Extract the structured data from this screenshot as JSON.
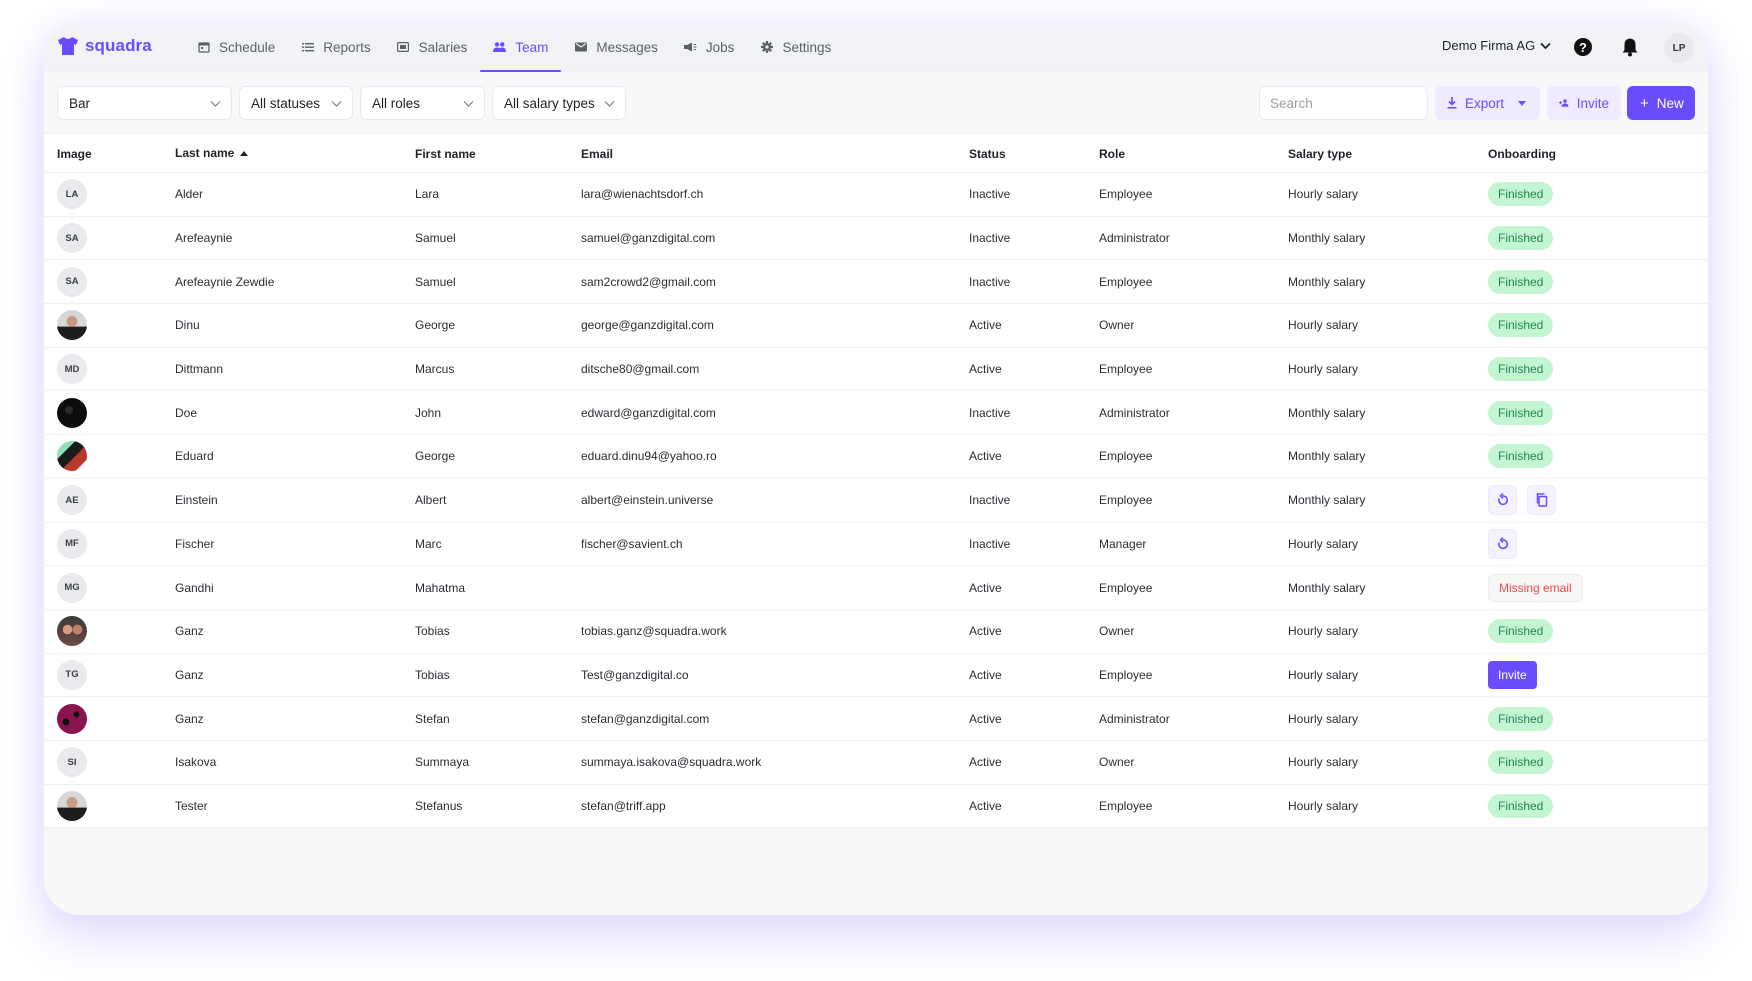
{
  "app": {
    "brand": "squadra",
    "brand_color": "#6a4cff"
  },
  "nav": {
    "items": [
      {
        "label": "Schedule",
        "icon": "calendar-icon",
        "active": false
      },
      {
        "label": "Reports",
        "icon": "list-icon",
        "active": false
      },
      {
        "label": "Salaries",
        "icon": "money-icon",
        "active": false
      },
      {
        "label": "Team",
        "icon": "people-icon",
        "active": true
      },
      {
        "label": "Messages",
        "icon": "mail-icon",
        "active": false
      },
      {
        "label": "Jobs",
        "icon": "megaphone-icon",
        "active": false
      },
      {
        "label": "Settings",
        "icon": "gear-icon",
        "active": false
      }
    ],
    "company": "Demo Firma AG",
    "user_initials": "LP"
  },
  "filters": {
    "location": "Bar",
    "status": "All statuses",
    "role": "All roles",
    "salary_type": "All salary types",
    "search_placeholder": "Search",
    "export_label": "Export",
    "invite_label": "Invite",
    "new_label": "New"
  },
  "table": {
    "columns": [
      "Image",
      "Last name",
      "First name",
      "Email",
      "Status",
      "Role",
      "Salary type",
      "Onboarding"
    ],
    "sort": {
      "column": "Last name",
      "direction": "ascending"
    },
    "rows": [
      {
        "initials": "LA",
        "photo": null,
        "last_name": "Alder",
        "first_name": "Lara",
        "email": "lara@wienachtsdorf.ch",
        "status": "Inactive",
        "role": "Employee",
        "salary_type": "Hourly salary",
        "onboarding": {
          "type": "finished",
          "label": "Finished"
        }
      },
      {
        "initials": "SA",
        "photo": null,
        "last_name": "Arefeaynie",
        "first_name": "Samuel",
        "email": "samuel@ganzdigital.com",
        "status": "Inactive",
        "role": "Administrator",
        "salary_type": "Monthly salary",
        "onboarding": {
          "type": "finished",
          "label": "Finished"
        }
      },
      {
        "initials": "SA",
        "photo": null,
        "last_name": "Arefeaynie Zewdie",
        "first_name": "Samuel",
        "email": "sam2crowd2@gmail.com",
        "status": "Inactive",
        "role": "Employee",
        "salary_type": "Monthly salary",
        "onboarding": {
          "type": "finished",
          "label": "Finished"
        }
      },
      {
        "initials": "",
        "photo": "portrait-gray",
        "last_name": "Dinu",
        "first_name": "George",
        "email": "george@ganzdigital.com",
        "status": "Active",
        "role": "Owner",
        "salary_type": "Hourly salary",
        "onboarding": {
          "type": "finished",
          "label": "Finished"
        }
      },
      {
        "initials": "MD",
        "photo": null,
        "last_name": "Dittmann",
        "first_name": "Marcus",
        "email": "ditsche80@gmail.com",
        "status": "Active",
        "role": "Employee",
        "salary_type": "Hourly salary",
        "onboarding": {
          "type": "finished",
          "label": "Finished"
        }
      },
      {
        "initials": "",
        "photo": "dark",
        "last_name": "Doe",
        "first_name": "John",
        "email": "edward@ganzdigital.com",
        "status": "Inactive",
        "role": "Administrator",
        "salary_type": "Monthly salary",
        "onboarding": {
          "type": "finished",
          "label": "Finished"
        }
      },
      {
        "initials": "",
        "photo": "illustration",
        "last_name": "Eduard",
        "first_name": "George",
        "email": "eduard.dinu94@yahoo.ro",
        "status": "Active",
        "role": "Employee",
        "salary_type": "Monthly salary",
        "onboarding": {
          "type": "finished",
          "label": "Finished"
        }
      },
      {
        "initials": "AE",
        "photo": null,
        "last_name": "Einstein",
        "first_name": "Albert",
        "email": "albert@einstein.universe",
        "status": "Inactive",
        "role": "Employee",
        "salary_type": "Monthly salary",
        "onboarding": {
          "type": "actions",
          "actions": [
            "resend",
            "copy"
          ]
        }
      },
      {
        "initials": "MF",
        "photo": null,
        "last_name": "Fischer",
        "first_name": "Marc",
        "email": "fischer@savient.ch",
        "status": "Inactive",
        "role": "Manager",
        "salary_type": "Hourly salary",
        "onboarding": {
          "type": "actions",
          "actions": [
            "resend"
          ]
        }
      },
      {
        "initials": "MG",
        "photo": null,
        "last_name": "Gandhi",
        "first_name": "Mahatma",
        "email": "",
        "status": "Active",
        "role": "Employee",
        "salary_type": "Monthly salary",
        "onboarding": {
          "type": "missing",
          "label": "Missing email"
        }
      },
      {
        "initials": "",
        "photo": "couple",
        "last_name": "Ganz",
        "first_name": "Tobias",
        "email": "tobias.ganz@squadra.work",
        "status": "Active",
        "role": "Owner",
        "salary_type": "Hourly salary",
        "onboarding": {
          "type": "finished",
          "label": "Finished"
        }
      },
      {
        "initials": "TG",
        "photo": null,
        "last_name": "Ganz",
        "first_name": "Tobias",
        "email": "Test@ganzdigital.co",
        "status": "Active",
        "role": "Employee",
        "salary_type": "Hourly salary",
        "onboarding": {
          "type": "invite",
          "label": "Invite"
        }
      },
      {
        "initials": "",
        "photo": "magenta",
        "last_name": "Ganz",
        "first_name": "Stefan",
        "email": "stefan@ganzdigital.com",
        "status": "Active",
        "role": "Administrator",
        "salary_type": "Hourly salary",
        "onboarding": {
          "type": "finished",
          "label": "Finished"
        }
      },
      {
        "initials": "SI",
        "photo": null,
        "last_name": "Isakova",
        "first_name": "Summaya",
        "email": "summaya.isakova@squadra.work",
        "status": "Active",
        "role": "Owner",
        "salary_type": "Hourly salary",
        "onboarding": {
          "type": "finished",
          "label": "Finished"
        }
      },
      {
        "initials": "",
        "photo": "portrait-gray",
        "last_name": "Tester",
        "first_name": "Stefanus",
        "email": "stefan@triff.app",
        "status": "Active",
        "role": "Employee",
        "salary_type": "Hourly salary",
        "onboarding": {
          "type": "finished",
          "label": "Finished"
        }
      }
    ]
  }
}
